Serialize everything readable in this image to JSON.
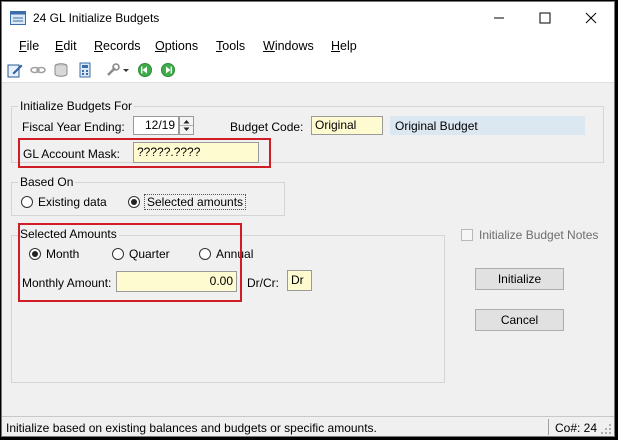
{
  "window": {
    "title": "24 GL Initialize Budgets"
  },
  "menu": {
    "items": [
      "File",
      "Edit",
      "Records",
      "Options",
      "Tools",
      "Windows",
      "Help"
    ]
  },
  "init_group": {
    "label": "Initialize Budgets For",
    "fiscal_year_label": "Fiscal Year Ending:",
    "fiscal_year_value": "12/19",
    "budget_code_label": "Budget Code:",
    "budget_code_value": "Original",
    "budget_code_description": "Original Budget",
    "gl_mask_label": "GL Account Mask:",
    "gl_mask_value": "?????.????"
  },
  "based_on": {
    "label": "Based On",
    "option_existing": "Existing data",
    "option_selected": "Selected amounts",
    "selected": "Selected amounts"
  },
  "selected_amounts": {
    "label": "Selected Amounts",
    "option_month": "Month",
    "option_quarter": "Quarter",
    "option_annual": "Annual",
    "selected": "Month",
    "monthly_amount_label": "Monthly Amount:",
    "monthly_amount_value": "0.00",
    "drcr_label": "Dr/Cr:",
    "drcr_value": "Dr"
  },
  "side": {
    "notes_checkbox_label": "Initialize Budget Notes",
    "notes_checked": false,
    "initialize_button": "Initialize",
    "cancel_button": "Cancel"
  },
  "status": {
    "message": "Initialize based on existing balances and budgets or specific amounts.",
    "company": "Co#: 24"
  },
  "colors": {
    "highlight_box": "#d01c25",
    "input_bg": "#fffbd0"
  }
}
